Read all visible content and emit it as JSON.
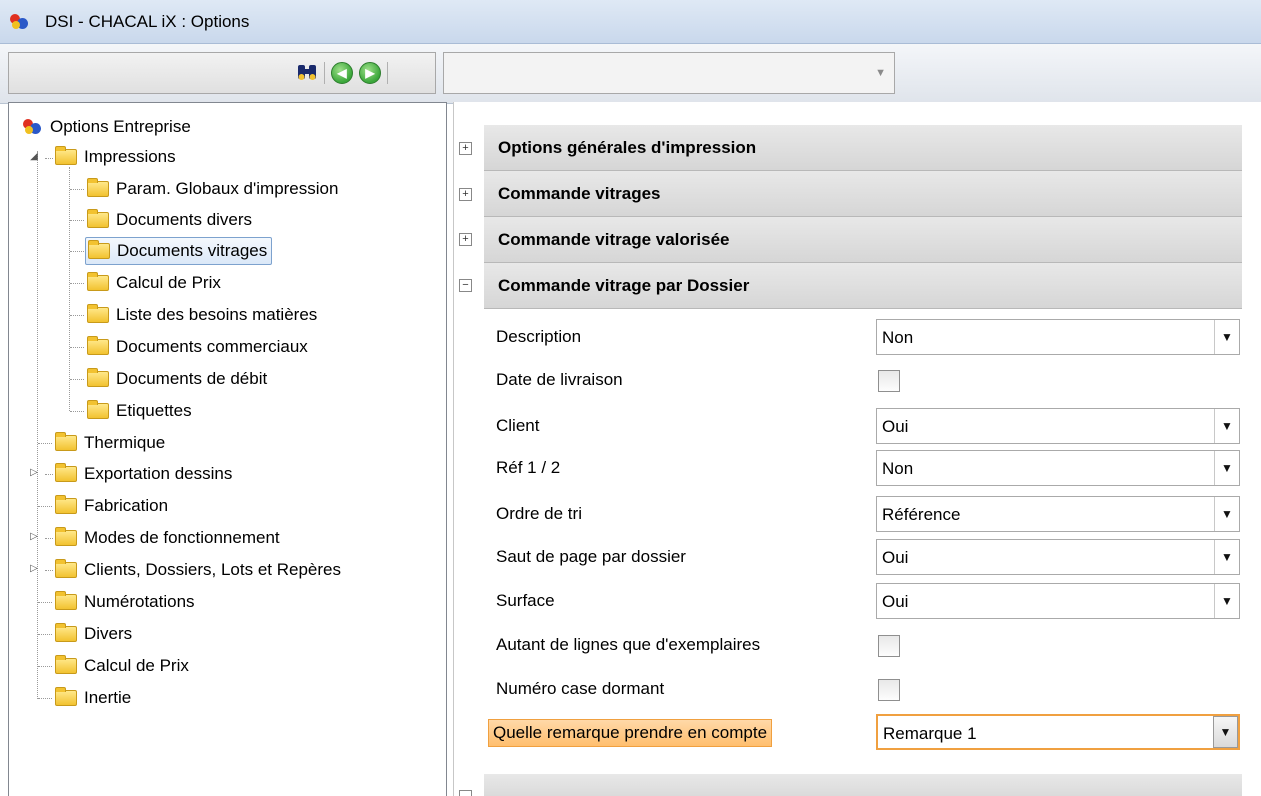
{
  "window": {
    "title": "DSI - CHACAL iX : Options"
  },
  "toolbar": {
    "search_value": "",
    "combo_value": ""
  },
  "tree": {
    "root": "Options Entreprise",
    "items": [
      {
        "label": "Impressions"
      },
      {
        "label": "Param. Globaux d'impression"
      },
      {
        "label": "Documents divers"
      },
      {
        "label": "Documents vitrages"
      },
      {
        "label": "Calcul de Prix"
      },
      {
        "label": "Liste des besoins matières"
      },
      {
        "label": "Documents commerciaux"
      },
      {
        "label": "Documents de débit"
      },
      {
        "label": "Etiquettes"
      },
      {
        "label": "Thermique"
      },
      {
        "label": "Exportation dessins"
      },
      {
        "label": "Fabrication"
      },
      {
        "label": "Modes de fonctionnement"
      },
      {
        "label": "Clients, Dossiers, Lots et Repères"
      },
      {
        "label": "Numérotations"
      },
      {
        "label": "Divers"
      },
      {
        "label": "Calcul de Prix"
      },
      {
        "label": "Inertie"
      }
    ]
  },
  "sections": [
    {
      "title": "Options générales d'impression",
      "toggle": "+"
    },
    {
      "title": "Commande vitrages",
      "toggle": "+"
    },
    {
      "title": "Commande vitrage valorisée",
      "toggle": "+"
    },
    {
      "title": "Commande vitrage par Dossier",
      "toggle": "−"
    }
  ],
  "properties": [
    {
      "label": "Description",
      "value": "Non"
    },
    {
      "label": "Date de livraison"
    },
    {
      "label": "Client",
      "value": "Oui"
    },
    {
      "label": "Réf 1 / 2",
      "value": "Non"
    },
    {
      "label": "Ordre de tri",
      "value": "Référence"
    },
    {
      "label": "Saut de page par dossier",
      "value": "Oui"
    },
    {
      "label": "Surface",
      "value": "Oui"
    },
    {
      "label": "Autant de lignes que d'exemplaires"
    },
    {
      "label": "Numéro case dormant"
    },
    {
      "label": "Quelle remarque prendre en compte",
      "value": "Remarque 1"
    }
  ],
  "icons": {
    "binoculars": "binoculars-icon",
    "back": "back-arrow-icon",
    "forward": "forward-arrow-icon",
    "expand_arrow": "▼"
  },
  "colors": {
    "highlight": "#ffbf6e",
    "highlight_border": "#f0a040",
    "selection": "#dbe8f8"
  }
}
